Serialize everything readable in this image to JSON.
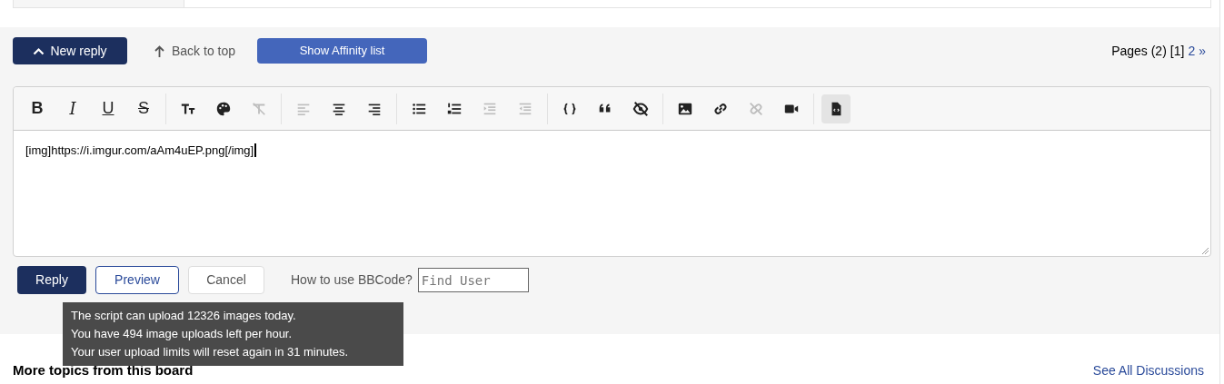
{
  "actions": {
    "new_reply": "New reply",
    "back_to_top": "Back to top",
    "affinity": "Show Affinity list"
  },
  "pagination": {
    "label": "Pages (2)",
    "pages": [
      {
        "label": "[1]",
        "selected": true
      },
      {
        "label": "2",
        "selected": false
      }
    ],
    "next": "»"
  },
  "editor": {
    "toolbar": [
      [
        {
          "kind": "bold",
          "glyph": "B",
          "disabled": false,
          "active": false
        },
        {
          "kind": "italic",
          "glyph": "I",
          "disabled": false,
          "active": false
        },
        {
          "kind": "underline",
          "glyph": "U",
          "disabled": false,
          "active": false
        },
        {
          "kind": "strike",
          "glyph": "S",
          "disabled": false,
          "active": false
        }
      ],
      [
        {
          "kind": "fontsize",
          "disabled": false,
          "active": false
        },
        {
          "kind": "color",
          "disabled": false,
          "active": false
        },
        {
          "kind": "removeformat",
          "disabled": true,
          "active": false
        }
      ],
      [
        {
          "kind": "alignleft",
          "disabled": true,
          "active": false
        },
        {
          "kind": "aligncenter",
          "disabled": false,
          "active": false
        },
        {
          "kind": "alignright",
          "disabled": false,
          "active": false
        }
      ],
      [
        {
          "kind": "bullets",
          "disabled": false,
          "active": false
        },
        {
          "kind": "numbers",
          "disabled": false,
          "active": false
        },
        {
          "kind": "indent",
          "disabled": true,
          "active": false
        },
        {
          "kind": "outdent",
          "disabled": true,
          "active": false
        }
      ],
      [
        {
          "kind": "code",
          "disabled": false,
          "active": false
        },
        {
          "kind": "quote",
          "disabled": false,
          "active": false
        },
        {
          "kind": "spoiler",
          "disabled": false,
          "active": false
        }
      ],
      [
        {
          "kind": "image",
          "disabled": false,
          "active": false
        },
        {
          "kind": "link",
          "disabled": false,
          "active": false
        },
        {
          "kind": "unlink",
          "disabled": true,
          "active": false
        },
        {
          "kind": "video",
          "disabled": false,
          "active": false
        }
      ],
      [
        {
          "kind": "source",
          "disabled": false,
          "active": true
        }
      ]
    ],
    "value": "[img]https://i.imgur.com/aAm4uEP.png[/img]"
  },
  "form": {
    "reply": "Reply",
    "preview": "Preview",
    "cancel": "Cancel",
    "bbcode": "How to use BBCode?",
    "find_user": {
      "placeholder": "Find User"
    }
  },
  "tooltip": [
    "The script can upload 12326 images today.",
    "You have 494 image uploads left per hour.",
    "Your user upload limits will reset again in 31 minutes."
  ],
  "footer": {
    "heading": "More topics from this board",
    "link": "See All Discussions"
  }
}
